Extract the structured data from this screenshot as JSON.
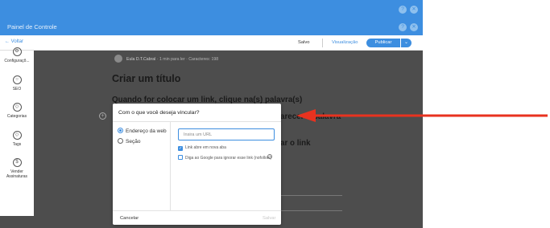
{
  "app": {
    "title": "Painel de Controle",
    "help_glyph": "?",
    "close_glyph": "✕"
  },
  "toolbar": {
    "back_label": "← Voltar",
    "saved_label": "Salvo",
    "view_label": "Visualização",
    "publish_label": "Publicar",
    "publish_menu_glyph": "⌄"
  },
  "sidebar": {
    "items": [
      {
        "label": "Configuraçõ...",
        "icon": "gear-icon",
        "glyph": "⚙"
      },
      {
        "label": "SEO",
        "icon": "search-icon",
        "glyph": "○"
      },
      {
        "label": "Categorias",
        "icon": "categories-icon",
        "glyph": "◇"
      },
      {
        "label": "Tags",
        "icon": "tag-icon",
        "glyph": "◇"
      },
      {
        "label": "Vender Assinaturas",
        "icon": "dollar-icon",
        "glyph": "$"
      }
    ]
  },
  "post": {
    "author": "Eula D.T.Cabral",
    "meta": "· 1 min para ler · Caracteres: 198",
    "title": "Criar um título",
    "heading1": "Quando for colocar um link, clique na(s) palavra(s)",
    "heading2": "arecer o palavra",
    "heading3": "ar o link",
    "add_glyph": "+"
  },
  "modal": {
    "title": "Com o que você deseja vincular?",
    "options": [
      "Endereço da web",
      "Seção"
    ],
    "selected_option": "Endereço da web",
    "url_placeholder": "Insira um URL",
    "url_value": "",
    "open_new_tab_label": "Link abre em nova aba",
    "open_new_tab_checked": true,
    "nofollow_label": "Diga ao Google para ignorar esse link (nofollow)",
    "nofollow_checked": false,
    "info_glyph": "?",
    "check_glyph": "✓",
    "cancel_label": "Cancelar",
    "save_label": "Salvar"
  },
  "colors": {
    "accent": "#3d8ee0",
    "overlay": "#4d4d4d",
    "annotation_arrow": "#e8321f"
  }
}
